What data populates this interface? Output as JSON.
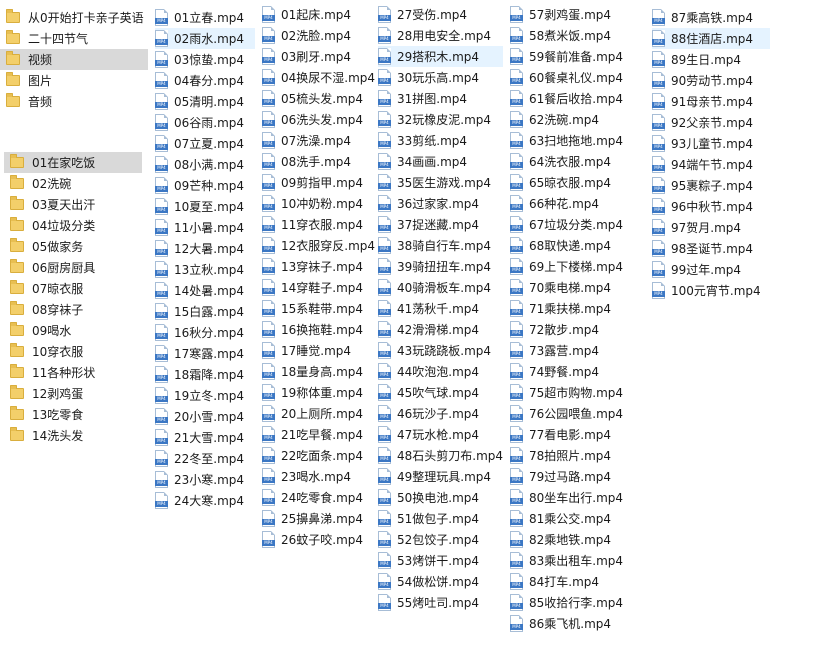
{
  "nav_tree": [
    {
      "label": "从0开始打卡亲子英语"
    },
    {
      "label": "二十四节气"
    },
    {
      "label": "视频",
      "selected": true
    },
    {
      "label": "图片"
    },
    {
      "label": "音频"
    }
  ],
  "subfolders": [
    "01在家吃饭",
    "02洗碗",
    "03夏天出汗",
    "04垃圾分类",
    "05做家务",
    "06厨房厨具",
    "07晾衣服",
    "08穿袜子",
    "09喝水",
    "10穿衣服",
    "11各种形状",
    "12剥鸡蛋",
    "13吃零食",
    "14洗头发"
  ],
  "file_icon_tag": "MP4",
  "file_columns": [
    [
      "01立春.mp4",
      "02雨水.mp4",
      "03惊蛰.mp4",
      "04春分.mp4",
      "05清明.mp4",
      "06谷雨.mp4",
      "07立夏.mp4",
      "08小满.mp4",
      "09芒种.mp4",
      "10夏至.mp4",
      "11小暑.mp4",
      "12大暑.mp4",
      "13立秋.mp4",
      "14处暑.mp4",
      "15白露.mp4",
      "16秋分.mp4",
      "17寒露.mp4",
      "18霜降.mp4",
      "19立冬.mp4",
      "20小雪.mp4",
      "21大雪.mp4",
      "22冬至.mp4",
      "23小寒.mp4",
      "24大寒.mp4"
    ],
    [
      "01起床.mp4",
      "02洗脸.mp4",
      "03刷牙.mp4",
      "04换尿不湿.mp4",
      "05梳头发.mp4",
      "06洗头发.mp4",
      "07洗澡.mp4",
      "08洗手.mp4",
      "09剪指甲.mp4",
      "10冲奶粉.mp4",
      "11穿衣服.mp4",
      "12衣服穿反.mp4",
      "13穿袜子.mp4",
      "14穿鞋子.mp4",
      "15系鞋带.mp4",
      "16换拖鞋.mp4",
      "17睡觉.mp4",
      "18量身高.mp4",
      "19称体重.mp4",
      "20上厕所.mp4",
      "21吃早餐.mp4",
      "22吃面条.mp4",
      "23喝水.mp4",
      "24吃零食.mp4",
      "25擤鼻涕.mp4",
      "26蚊子咬.mp4"
    ],
    [
      "27受伤.mp4",
      "28用电安全.mp4",
      "29搭积木.mp4",
      "30玩乐高.mp4",
      "31拼图.mp4",
      "32玩橡皮泥.mp4",
      "33剪纸.mp4",
      "34画画.mp4",
      "35医生游戏.mp4",
      "36过家家.mp4",
      "37捉迷藏.mp4",
      "38骑自行车.mp4",
      "39骑扭扭车.mp4",
      "40骑滑板车.mp4",
      "41荡秋千.mp4",
      "42滑滑梯.mp4",
      "43玩跷跷板.mp4",
      "44吹泡泡.mp4",
      "45吹气球.mp4",
      "46玩沙子.mp4",
      "47玩水枪.mp4",
      "48石头剪刀布.mp4",
      "49整理玩具.mp4",
      "50换电池.mp4",
      "51做包子.mp4",
      "52包饺子.mp4",
      "53烤饼干.mp4",
      "54做松饼.mp4",
      "55烤吐司.mp4"
    ],
    [
      "57剥鸡蛋.mp4",
      "58煮米饭.mp4",
      "59餐前准备.mp4",
      "60餐桌礼仪.mp4",
      "61餐后收拾.mp4",
      "62洗碗.mp4",
      "63扫地拖地.mp4",
      "64洗衣服.mp4",
      "65晾衣服.mp4",
      "66种花.mp4",
      "67垃圾分类.mp4",
      "68取快递.mp4",
      "69上下楼梯.mp4",
      "70乘电梯.mp4",
      "71乘扶梯.mp4",
      "72散步.mp4",
      "73露营.mp4",
      "74野餐.mp4",
      "75超市购物.mp4",
      "76公园喂鱼.mp4",
      "77看电影.mp4",
      "78拍照片.mp4",
      "79过马路.mp4",
      "80坐车出行.mp4",
      "81乘公交.mp4",
      "82乘地铁.mp4",
      "83乘出租车.mp4",
      "84打车.mp4",
      "85收拾行李.mp4",
      "86乘飞机.mp4"
    ],
    [
      "87乘高铁.mp4",
      "88住酒店.mp4",
      "89生日.mp4",
      "90劳动节.mp4",
      "91母亲节.mp4",
      "92父亲节.mp4",
      "93儿童节.mp4",
      "94端午节.mp4",
      "95裹粽子.mp4",
      "96中秋节.mp4",
      "97贺月.mp4",
      "98圣诞节.mp4",
      "99过年.mp4",
      "100元宵节.mp4"
    ]
  ]
}
